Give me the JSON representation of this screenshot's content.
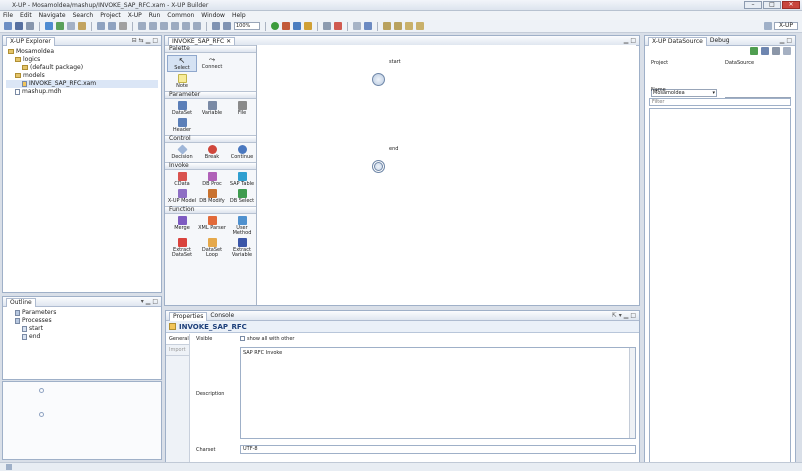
{
  "window": {
    "title": "X-UP - Mosamoldea/mashup/INVOKE_SAP_RFC.xam - X-UP Builder"
  },
  "menu": [
    "File",
    "Edit",
    "Navigate",
    "Search",
    "Project",
    "X-UP",
    "Run",
    "Common",
    "Window",
    "Help"
  ],
  "toolbar": {
    "zoom": "100%",
    "perspective": "X-UP"
  },
  "explorer": {
    "tab": "X-UP Explorer",
    "items": [
      {
        "label": "Mosamoldea",
        "depth": 0,
        "kind": "folder"
      },
      {
        "label": "logics",
        "depth": 1,
        "kind": "folder"
      },
      {
        "label": "(default package)",
        "depth": 2,
        "kind": "folder"
      },
      {
        "label": "models",
        "depth": 1,
        "kind": "folder"
      },
      {
        "label": "INVOKE_SAP_RFC.xam",
        "depth": 2,
        "kind": "file",
        "selected": true
      },
      {
        "label": "mashup.mdh",
        "depth": 1,
        "kind": "file"
      }
    ]
  },
  "outline": {
    "tab": "Outline",
    "items": [
      {
        "label": "Parameters",
        "depth": 1
      },
      {
        "label": "Processes",
        "depth": 1
      },
      {
        "label": "start",
        "depth": 2
      },
      {
        "label": "end",
        "depth": 2
      }
    ]
  },
  "editor": {
    "tab": "INVOKE_SAP_RFC"
  },
  "palette": {
    "title": "Palette",
    "tools": [
      {
        "label": "Select"
      },
      {
        "label": "Connect"
      },
      {
        "label": "Note"
      }
    ],
    "sections": [
      {
        "title": "Parameter",
        "items": [
          {
            "label": "DataSet",
            "color": "#5b7fb8"
          },
          {
            "label": "Variable",
            "color": "#7a8aa5"
          },
          {
            "label": "File",
            "color": "#8a8a8a"
          },
          {
            "label": "Header",
            "color": "#5b7fb8"
          }
        ]
      },
      {
        "title": "Control",
        "items": [
          {
            "label": "Decision",
            "color": "#9fb6d8"
          },
          {
            "label": "Break",
            "color": "#d0473c"
          },
          {
            "label": "Continue",
            "color": "#4a78c0"
          }
        ]
      },
      {
        "title": "Invoke",
        "items": [
          {
            "label": "CData",
            "color": "#d9534f"
          },
          {
            "label": "DB Proc",
            "color": "#b061b8"
          },
          {
            "label": "SAP Table",
            "color": "#2f9fd0"
          },
          {
            "label": "X-UP Model",
            "color": "#8e6fc4"
          },
          {
            "label": "DB Modify",
            "color": "#c9722f"
          },
          {
            "label": "DB Select",
            "color": "#3e9b4f"
          }
        ]
      },
      {
        "title": "Function",
        "items": [
          {
            "label": "Merge",
            "color": "#7e5bc2"
          },
          {
            "label": "XML Parser",
            "color": "#e26a3a"
          },
          {
            "label": "User Method",
            "color": "#4f91cf"
          },
          {
            "label": "Extract DataSet",
            "color": "#d9433d"
          },
          {
            "label": "DataSet Loop",
            "color": "#e5a84a"
          },
          {
            "label": "Extract Variable",
            "color": "#3b56a8"
          }
        ]
      }
    ]
  },
  "canvas": {
    "start_label": "start",
    "end_label": "end"
  },
  "properties": {
    "tabs": [
      "Properties",
      "Console"
    ],
    "title": "INVOKE_SAP_RFC",
    "side_tabs": [
      "General",
      "Import"
    ],
    "visible_label": "Visible",
    "visible_check": "show all with other",
    "description_label": "Description",
    "description_value": "SAP RFC Invoke",
    "charset_label": "Charset",
    "charset_value": "UTF-8"
  },
  "datasource": {
    "tabs": [
      "X-UP DataSource",
      "Debug"
    ],
    "project_label": "Project",
    "project_value": "Mosamoldea",
    "datasource_label": "DataSource",
    "datasource_value": "",
    "name_label": "Name",
    "filter_label": "Filter"
  }
}
